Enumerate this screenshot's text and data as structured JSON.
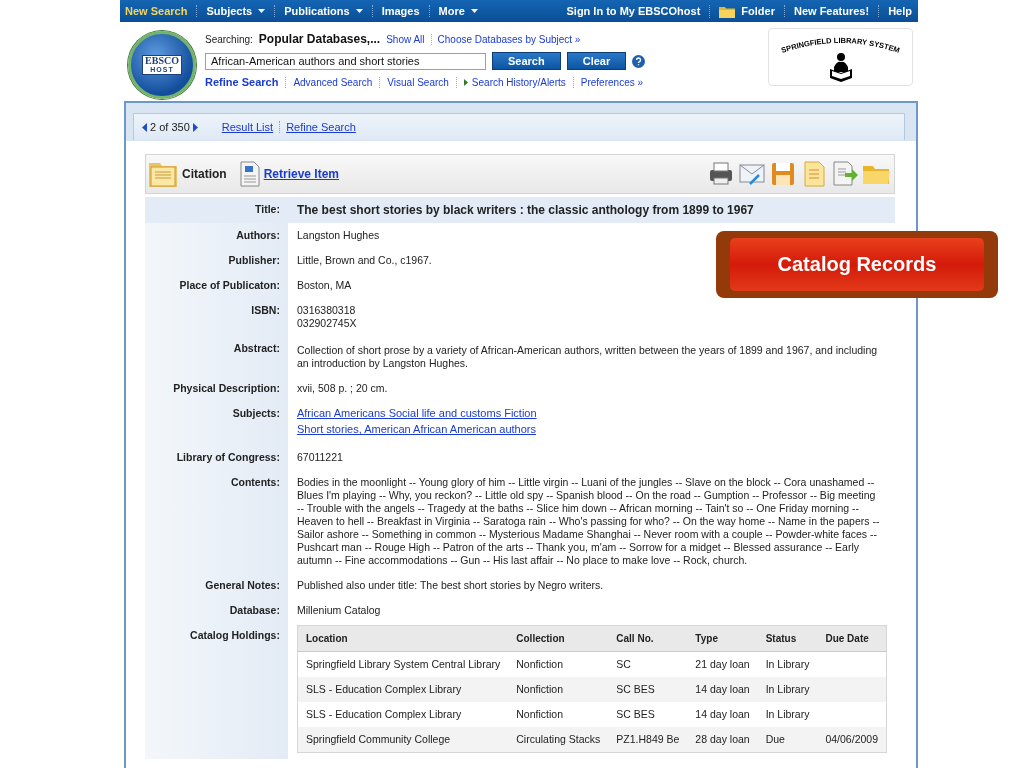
{
  "top_nav": {
    "left": [
      {
        "label": "New Search",
        "selected": true,
        "dropdown": false
      },
      {
        "label": "Subjects",
        "selected": false,
        "dropdown": true
      },
      {
        "label": "Publications",
        "selected": false,
        "dropdown": true
      },
      {
        "label": "Images",
        "selected": false,
        "dropdown": false
      },
      {
        "label": "More",
        "selected": false,
        "dropdown": true
      }
    ],
    "right": [
      {
        "label": "Sign In to My EBSCOhost",
        "kind": "link"
      },
      {
        "label": "Folder",
        "kind": "folder"
      },
      {
        "label": "New Features!",
        "kind": "link"
      },
      {
        "label": "Help",
        "kind": "link"
      }
    ]
  },
  "header": {
    "logo_text": [
      "EBSCO",
      "HOST"
    ],
    "searching_label": "Searching:",
    "databases": "Popular Databases,...",
    "links": [
      "Show All",
      "Choose Databases by Subject »"
    ],
    "query": "African-American authors and short stories",
    "buttons": [
      "Search",
      "Clear"
    ],
    "sub_links": [
      {
        "label": "Refine Search",
        "selected": true,
        "kind": "link"
      },
      {
        "label": "Advanced Search",
        "selected": false,
        "kind": "link"
      },
      {
        "label": "Visual Search",
        "selected": false,
        "kind": "link"
      },
      {
        "label": "Search History/Alerts",
        "selected": false,
        "kind": "expander"
      },
      {
        "label": "Preferences »",
        "selected": false,
        "kind": "link"
      }
    ],
    "library_logo": "SPRINGFIELD LIBRARY SYSTEM"
  },
  "result_nav": {
    "position": "2 of 350",
    "links": [
      "Result List",
      "Refine Search"
    ]
  },
  "toolbar": {
    "view": "Citation",
    "retrieve": "Retrieve Item"
  },
  "record": [
    {
      "label": "Title:",
      "kind": "title",
      "values": [
        "The best short stories by black writers : the classic anthology from 1899 to 1967"
      ]
    },
    {
      "label": "Authors:",
      "kind": "text",
      "values": [
        "Langston Hughes"
      ]
    },
    {
      "label": "Publisher:",
      "kind": "text",
      "values": [
        "Little, Brown and Co., c1967."
      ]
    },
    {
      "label": "Place of Publicaton:",
      "kind": "text",
      "values": [
        "Boston, MA"
      ]
    },
    {
      "label": "ISBN:",
      "kind": "text",
      "values": [
        "0316380318",
        "032902745X"
      ]
    },
    {
      "label": "Abstract:",
      "kind": "text",
      "values": [
        "Collection of short prose by a variety of African-American authors,  written between the years of 1899 and 1967, and including an introduction by Langston Hughes."
      ]
    },
    {
      "label": "Physical Description:",
      "kind": "text",
      "values": [
        "xvii, 508 p. ; 20 cm."
      ]
    },
    {
      "label": "Subjects:",
      "kind": "links",
      "values": [
        "African Americans Social life and customs Fiction",
        "Short stories, American African American authors"
      ]
    },
    {
      "label": "Library of Congress:",
      "kind": "text",
      "values": [
        "67011221"
      ]
    },
    {
      "label": "Contents:",
      "kind": "text",
      "values": [
        "Bodies in the moonlight -- Young glory of him -- Little virgin -- Luani of the jungles -- Slave on the block -- Cora unashamed -- Blues I'm playing -- Why, you reckon? -- Little old spy -- Spanish blood -- On the road -- Gumption -- Professor -- Big meeting -- Trouble with the angels -- Tragedy at the baths -- Slice him down -- African morning -- Tain't so -- One Friday morning -- Heaven to hell -- Breakfast in Virginia -- Saratoga rain -- Who's passing for who? -- On the way home -- Name in the papers -- Sailor ashore -- Something in common -- Mysterious Madame Shanghai -- Never room with a couple -- Powder-white faces -- Pushcart man -- Rouge High -- Patron of the arts -- Thank you, m'am -- Sorrow for a midget -- Blessed assurance -- Early autumn -- Fine accommodations -- Gun -- His last affair -- No place to make love -- Rock, church."
      ]
    },
    {
      "label": "General Notes:",
      "kind": "text",
      "values": [
        "Published also under title: The best short stories by Negro writers."
      ]
    },
    {
      "label": "Database:",
      "kind": "text",
      "values": [
        "Millenium Catalog"
      ]
    },
    {
      "label": "Catalog Holdings:",
      "kind": "holdings"
    }
  ],
  "holdings": {
    "columns": [
      "Location",
      "Collection",
      "Call No.",
      "Type",
      "Status",
      "Due Date"
    ],
    "rows": [
      [
        "Springfield Library System Central Library",
        "Nonfiction",
        "SC",
        "21 day loan",
        "In Library",
        ""
      ],
      [
        "SLS - Education Complex Library",
        "Nonfiction",
        "SC BES",
        "14 day loan",
        "In Library",
        ""
      ],
      [
        "SLS - Education Complex Library",
        "Nonfiction",
        "SC BES",
        "14 day loan",
        "In Library",
        ""
      ],
      [
        "Springfield Community College",
        "Circulating Stacks",
        "PZ1.H849 Be",
        "28 day loan",
        "Due",
        "04/06/2009"
      ]
    ]
  },
  "callout": {
    "label": "Catalog Records"
  }
}
